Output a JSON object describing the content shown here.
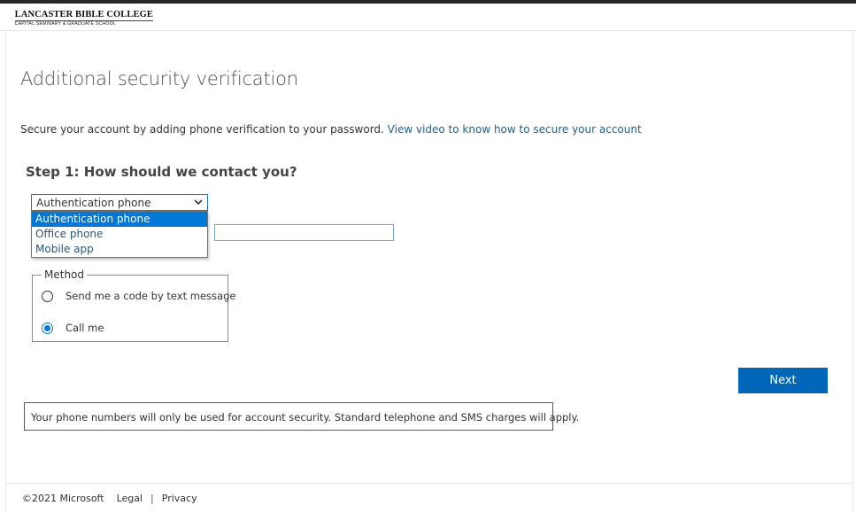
{
  "header": {
    "logo_line1": "LANCASTER BIBLE COLLEGE",
    "logo_line2": "CAPITAL SEMINARY & GRADUATE SCHOOL",
    "logo_icon": "lbc-logo-icon"
  },
  "main": {
    "title": "Additional security verification",
    "intro_text": "Secure your account by adding phone verification to your password. ",
    "intro_link": "View video to know how to secure your account",
    "step_title": "Step 1: How should we contact you?"
  },
  "contact_select": {
    "selected": "Authentication phone",
    "options": [
      "Authentication phone",
      "Office phone",
      "Mobile app"
    ],
    "chevron_icon": "chevron-down-icon"
  },
  "phone": {
    "value": ""
  },
  "method": {
    "legend": "Method",
    "options": [
      {
        "label": "Send me a code by text message",
        "checked": false
      },
      {
        "label": "Call me",
        "checked": true
      }
    ]
  },
  "actions": {
    "next_label": "Next"
  },
  "notice": {
    "text": "Your phone numbers will only be used for account security. Standard telephone and SMS charges will apply."
  },
  "footer": {
    "copyright": "©2021 Microsoft",
    "legal": "Legal",
    "separator": "|",
    "privacy": "Privacy"
  },
  "colors": {
    "accent": "#0078d7",
    "button": "#0067b8",
    "link": "#1f5f8b"
  }
}
